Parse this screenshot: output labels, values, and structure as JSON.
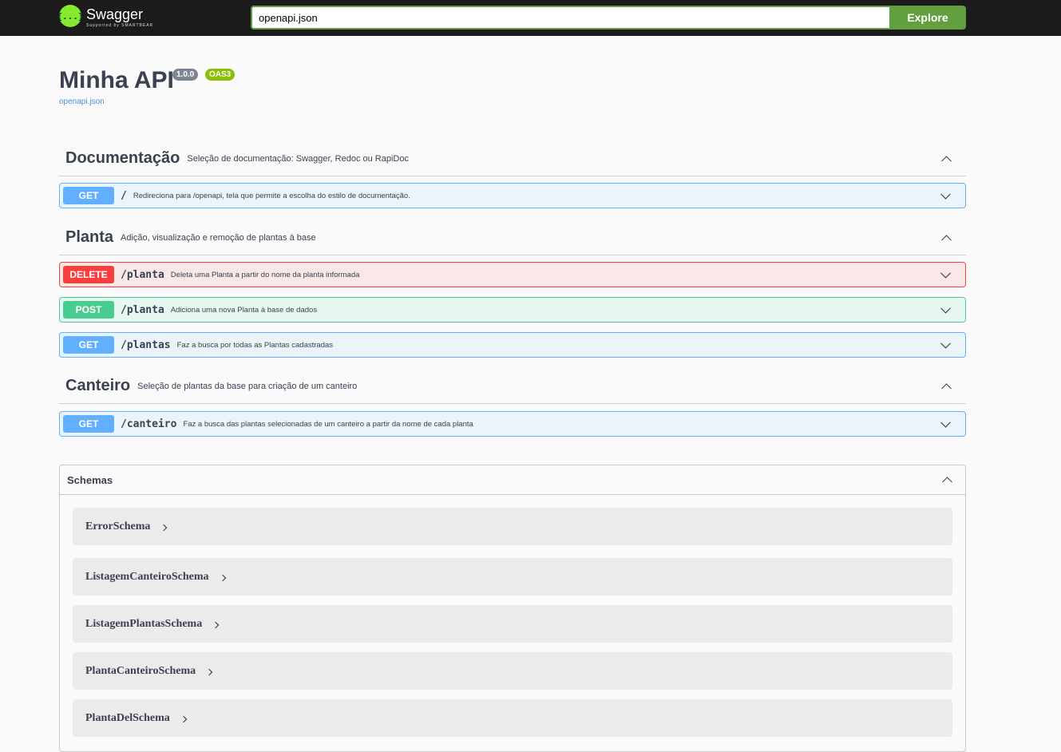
{
  "topbar": {
    "logo_name": "Swagger",
    "logo_sub": "Supported by SMARTBEAR",
    "logo_glyph": "{...}",
    "url_value": "openapi.json",
    "explore_label": "Explore"
  },
  "info": {
    "title": "Minha API",
    "version": "1.0.0",
    "oas": "OAS3",
    "spec_link": "openapi.json"
  },
  "tags": [
    {
      "name": "Documentação",
      "description": "Seleção de documentação: Swagger, Redoc ou RapiDoc",
      "operations": [
        {
          "method": "GET",
          "path": "/",
          "summary": "Redireciona para /openapi, tela que permite a escolha do estilo de documentação."
        }
      ]
    },
    {
      "name": "Planta",
      "description": "Adição, visualização e remoção de plantas à base",
      "operations": [
        {
          "method": "DELETE",
          "path": "/planta",
          "summary": "Deleta uma Planta a partir do nome da planta informada"
        },
        {
          "method": "POST",
          "path": "/planta",
          "summary": "Adiciona uma nova Planta à base de dados"
        },
        {
          "method": "GET",
          "path": "/plantas",
          "summary": "Faz a busca por todas as Plantas cadastradas"
        }
      ]
    },
    {
      "name": "Canteiro",
      "description": "Seleção de plantas da base para criação de um canteiro",
      "operations": [
        {
          "method": "GET",
          "path": "/canteiro",
          "summary": "Faz a busca das plantas selecionadas de um canteiro a partir da nome de cada planta"
        }
      ]
    }
  ],
  "schemas": {
    "title": "Schemas",
    "items": [
      "ErrorSchema",
      "ListagemCanteiroSchema",
      "ListagemPlantasSchema",
      "PlantaCanteiroSchema",
      "PlantaDelSchema"
    ]
  },
  "colors": {
    "get": "#61affe",
    "delete": "#f93e3e",
    "post": "#49cc90",
    "accent": "#62a03f"
  }
}
